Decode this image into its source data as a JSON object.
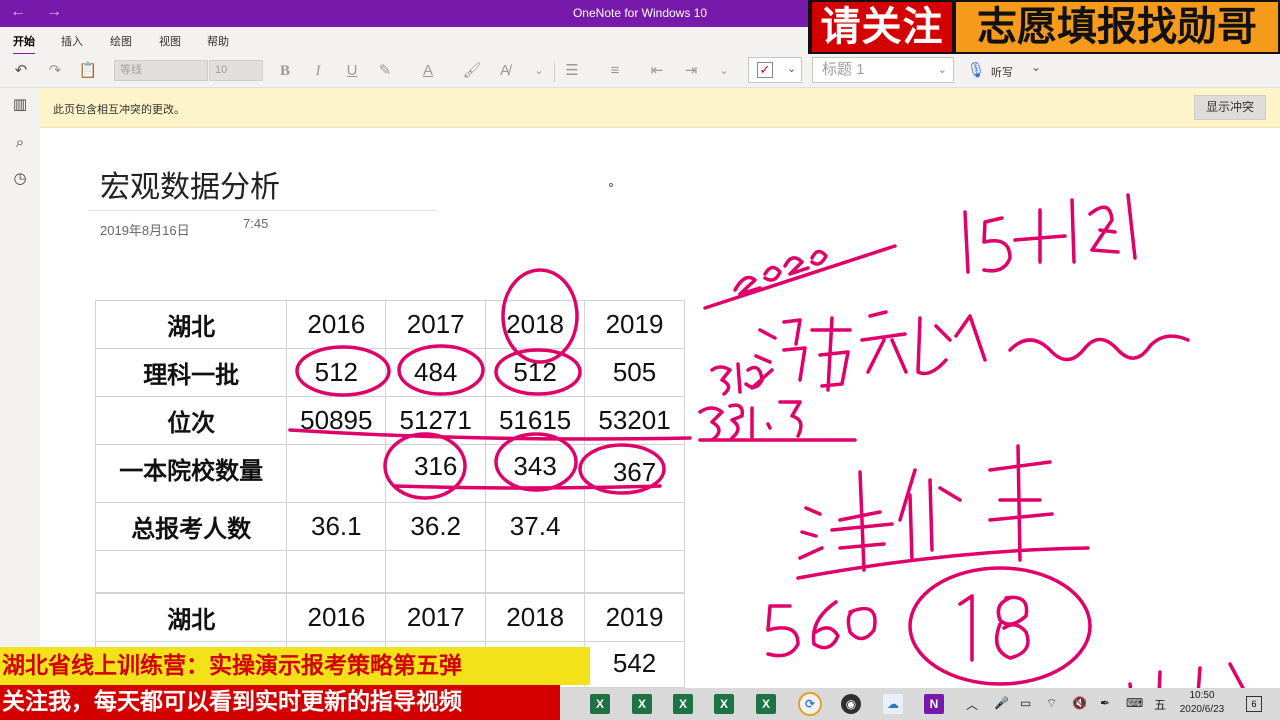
{
  "window": {
    "title": "OneNote for Windows 10",
    "back_icon": "arrow-left-icon",
    "forward_icon": "arrow-right-icon"
  },
  "ribbon": {
    "tabs": [
      "开始",
      "插入",
      "绘图",
      "视图",
      "帮助"
    ],
    "font_name": "等线",
    "font_size": "10",
    "style": "标题 1",
    "dictate": "听写"
  },
  "conflict_bar": {
    "message": "此页包含相互冲突的更改。",
    "button": "显示冲突"
  },
  "page": {
    "title": "宏观数据分析",
    "date": "2019年8月16日",
    "time": "7:45"
  },
  "table1": {
    "rows": [
      [
        "湖北",
        "2016",
        "2017",
        "2018",
        "2019"
      ],
      [
        "理科一批",
        "512",
        "484",
        "512",
        "505"
      ],
      [
        "位次",
        "50895",
        "51271",
        "51615",
        "53201"
      ],
      [
        "一本院校数量",
        "",
        "316",
        "343",
        "367"
      ],
      [
        "总报考人数",
        "36.1",
        "36.2",
        "37.4",
        ""
      ],
      [
        "",
        "",
        "",
        "",
        ""
      ]
    ]
  },
  "table2": {
    "rows": [
      [
        "湖北",
        "2016",
        "2017",
        "2018",
        "2019"
      ],
      [
        "",
        "",
        "",
        "",
        "542"
      ]
    ]
  },
  "promo": {
    "top_left": "请关注",
    "top_right": "志愿填报找勋哥",
    "line1": "湖北省线上训练营：实操演示报考策略第五弹",
    "line2": "关注我，每天都可以看到实时更新的指导视频"
  },
  "taskbar": {
    "time": "10:50",
    "date": "2020/6/23",
    "ime": "五",
    "notifications": "6"
  },
  "colors": {
    "onenote_purple": "#7719aa",
    "ink": "#e0006a",
    "promo_red": "#d40000",
    "promo_yellow": "#f3e21a",
    "promo_orange": "#f59a1b"
  }
}
